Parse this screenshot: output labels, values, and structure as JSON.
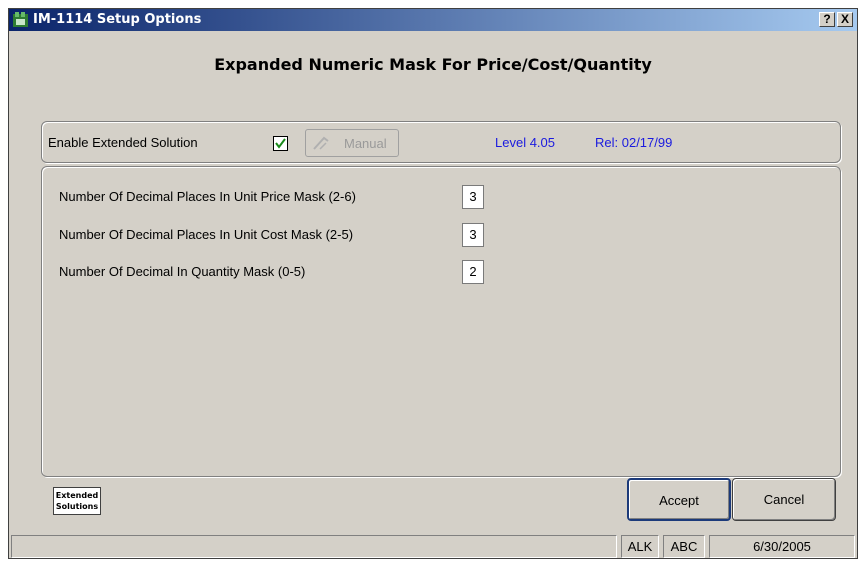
{
  "window": {
    "title": "IM-1114 Setup Options",
    "help_label": "?",
    "close_label": "X"
  },
  "heading": "Expanded Numeric Mask For Price/Cost/Quantity",
  "solution": {
    "enable_label": "Enable Extended Solution",
    "enabled": true,
    "manual_label": "Manual",
    "level": "Level 4.05",
    "release": "Rel: 02/17/99"
  },
  "fields": [
    {
      "label": "Number Of Decimal Places In Unit Price Mask (2-6)",
      "value": "3"
    },
    {
      "label": "Number Of Decimal Places In Unit Cost Mask (2-5)",
      "value": "3"
    },
    {
      "label": "Number Of Decimal In Quantity Mask (0-5)",
      "value": "2"
    }
  ],
  "logo": {
    "line1": "Extended",
    "line2": "Solutions"
  },
  "buttons": {
    "accept": "Accept",
    "cancel": "Cancel"
  },
  "status": {
    "cell1": "",
    "user": "ALK",
    "company": "ABC",
    "date": "6/30/2005"
  },
  "colors": {
    "title_bar": "#0a246a",
    "info_text": "#1a1adf",
    "check": "#1a8a1a"
  }
}
